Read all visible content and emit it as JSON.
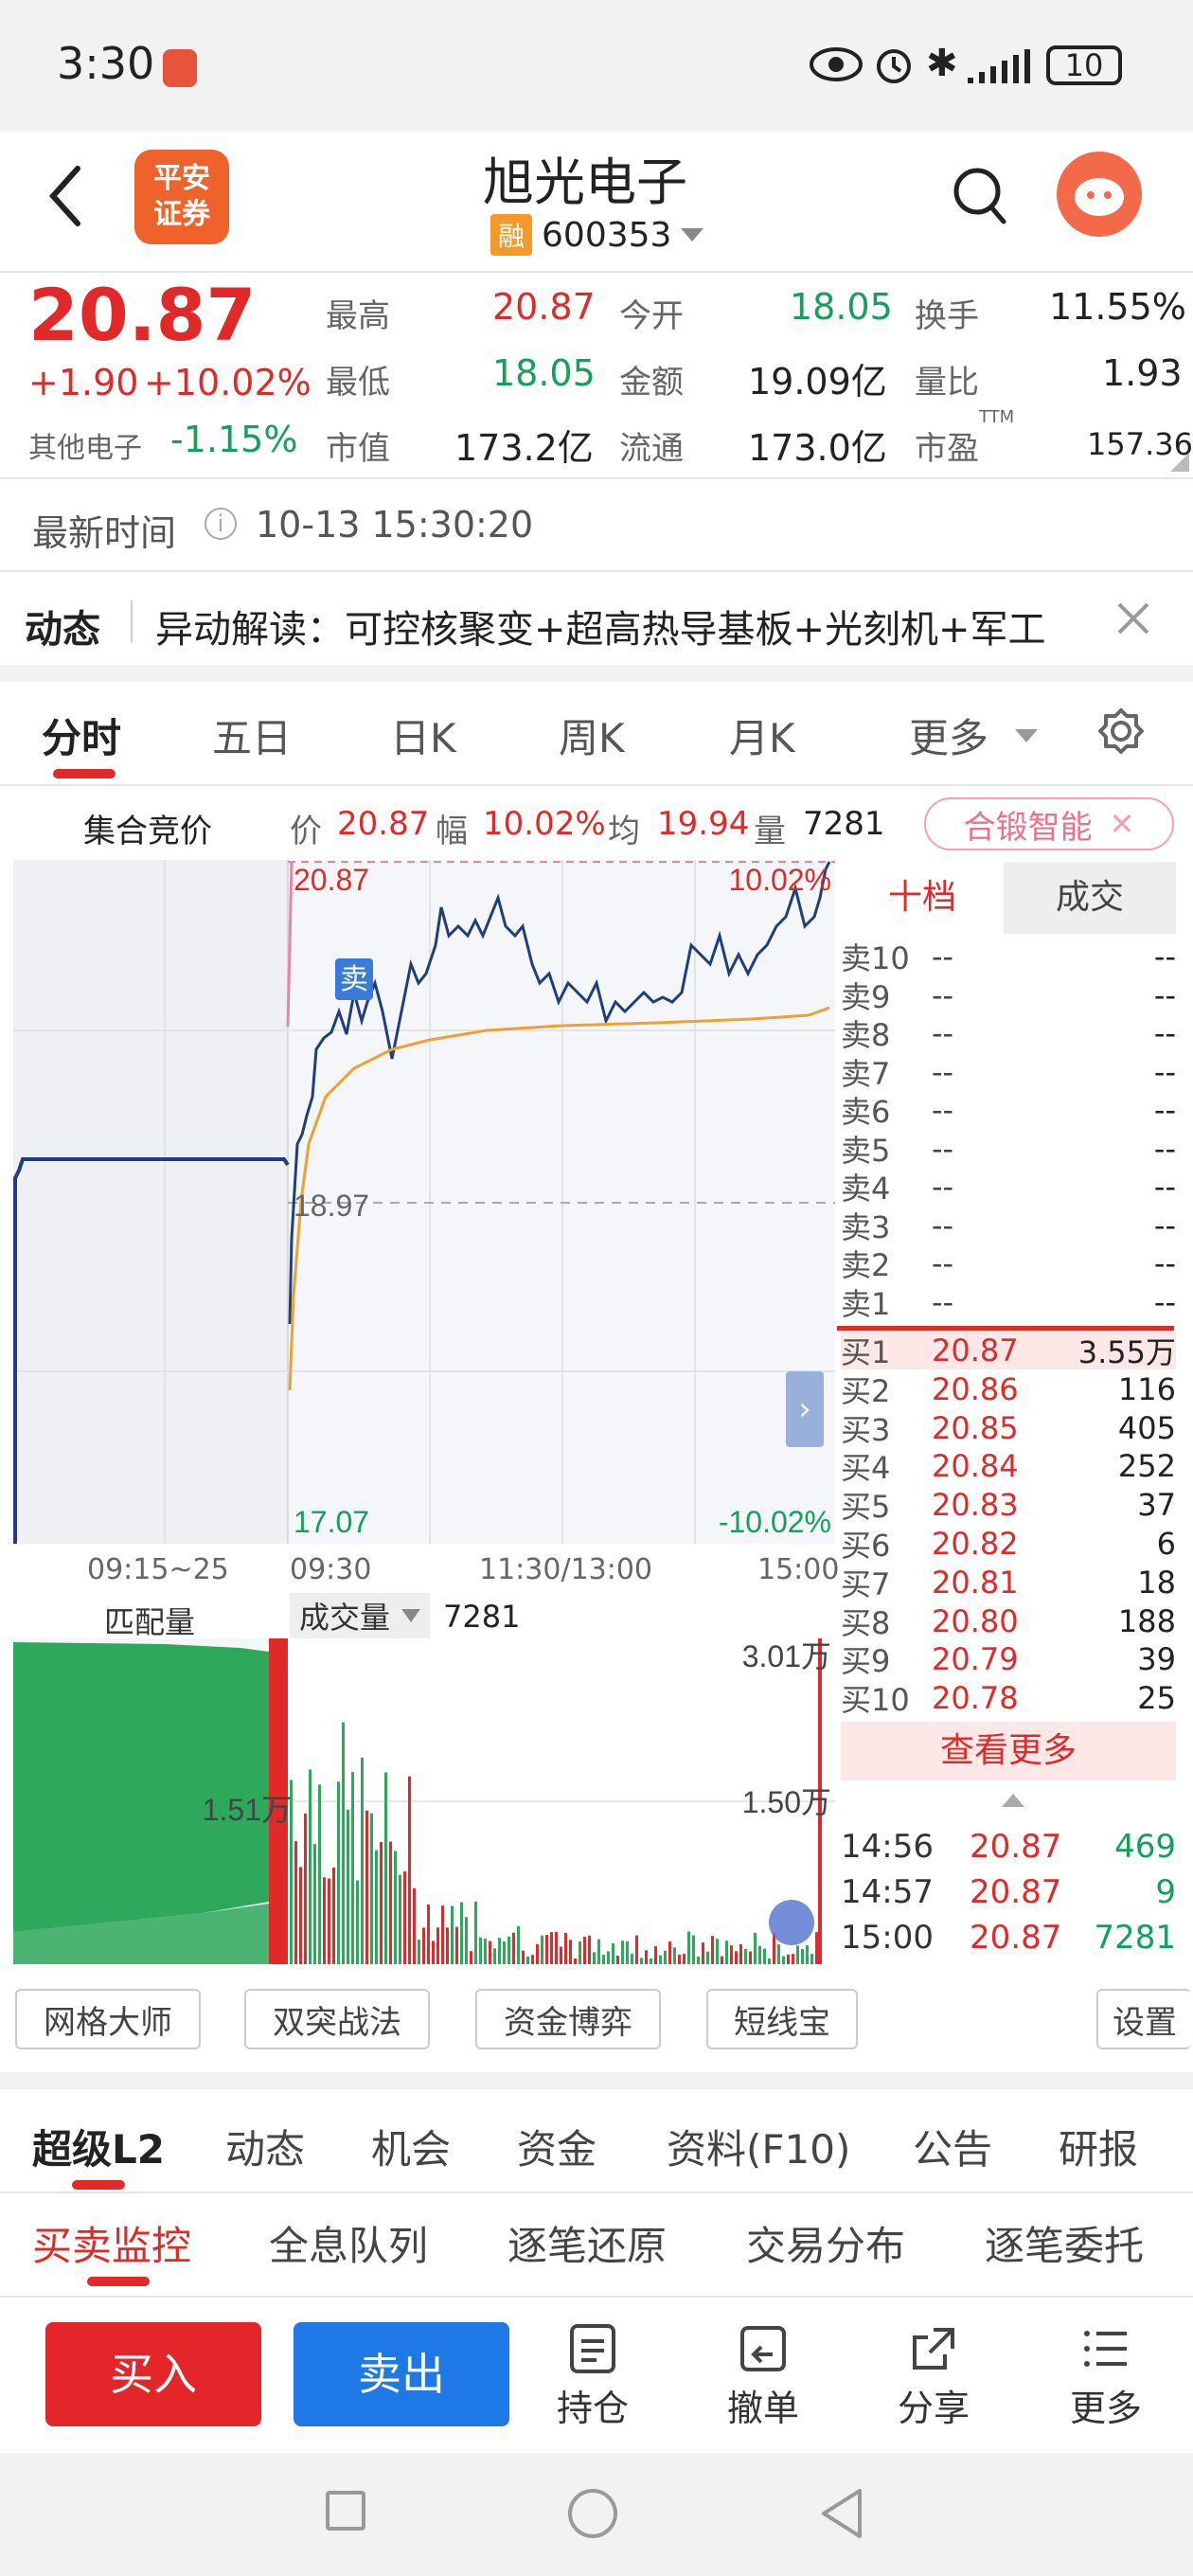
{
  "status_bar": {
    "time": "3:30",
    "battery": "10"
  },
  "header": {
    "broker_logo_text": "平安证券",
    "stock_name": "旭光电子",
    "margin_badge": "融",
    "stock_code": "600353"
  },
  "quote": {
    "price": "20.87",
    "change": "+1.90",
    "change_pct": "+10.02%",
    "sector_label": "其他电子",
    "sector_change": "-1.15%",
    "high_label": "最高",
    "high": "20.87",
    "open_label": "今开",
    "open": "18.05",
    "turnover_label": "换手",
    "turnover": "11.55%",
    "low_label": "最低",
    "low": "18.05",
    "amount_label": "金额",
    "amount": "19.09亿",
    "vol_ratio_label": "量比",
    "vol_ratio": "1.93",
    "mktcap_label": "市值",
    "mktcap": "173.2亿",
    "float_label": "流通",
    "float": "173.0亿",
    "pe_label": "市盈",
    "pe_sup": "TTM",
    "pe": "157.36"
  },
  "latest_time": {
    "label": "最新时间",
    "value": "10-13 15:30:20"
  },
  "news": {
    "tag": "动态",
    "text": "异动解读：可控核聚变+超高热导基板+光刻机+军工"
  },
  "chart_tabs": [
    "分时",
    "五日",
    "日K",
    "周K",
    "月K",
    "更多"
  ],
  "auction": {
    "label": "集合竞价",
    "price_label": "价",
    "price": "20.87",
    "pct_label": "幅",
    "pct": "10.02%",
    "avg_label": "均",
    "avg": "19.94",
    "vol_label": "量",
    "vol": "7281",
    "ai_label": "合锻智能"
  },
  "chart_labels": {
    "top_price": "20.87",
    "top_pct": "10.02%",
    "mid_price": "18.97",
    "bot_price": "17.07",
    "bot_pct": "-10.02%",
    "sell_marker": "卖",
    "t1": "09:15~25",
    "t2": "09:30",
    "t3": "11:30/13:00",
    "t4": "15:00"
  },
  "volume_panel": {
    "match_label": "匹配量",
    "vol_label": "成交量",
    "vol_value": "7281",
    "max_label": "3.01万",
    "mid_label": "1.50万",
    "auction_mid": "1.51万"
  },
  "orderbook": {
    "tab1": "十档",
    "tab2": "成交",
    "asks": [
      {
        "l": "卖10",
        "p": "--",
        "v": "--"
      },
      {
        "l": "卖9",
        "p": "--",
        "v": "--"
      },
      {
        "l": "卖8",
        "p": "--",
        "v": "--"
      },
      {
        "l": "卖7",
        "p": "--",
        "v": "--"
      },
      {
        "l": "卖6",
        "p": "--",
        "v": "--"
      },
      {
        "l": "卖5",
        "p": "--",
        "v": "--"
      },
      {
        "l": "卖4",
        "p": "--",
        "v": "--"
      },
      {
        "l": "卖3",
        "p": "--",
        "v": "--"
      },
      {
        "l": "卖2",
        "p": "--",
        "v": "--"
      },
      {
        "l": "卖1",
        "p": "--",
        "v": "--"
      }
    ],
    "bids": [
      {
        "l": "买1",
        "p": "20.87",
        "v": "3.55万"
      },
      {
        "l": "买2",
        "p": "20.86",
        "v": "116"
      },
      {
        "l": "买3",
        "p": "20.85",
        "v": "405"
      },
      {
        "l": "买4",
        "p": "20.84",
        "v": "252"
      },
      {
        "l": "买5",
        "p": "20.83",
        "v": "37"
      },
      {
        "l": "买6",
        "p": "20.82",
        "v": "6"
      },
      {
        "l": "买7",
        "p": "20.81",
        "v": "18"
      },
      {
        "l": "买8",
        "p": "20.80",
        "v": "188"
      },
      {
        "l": "买9",
        "p": "20.79",
        "v": "39"
      },
      {
        "l": "买10",
        "p": "20.78",
        "v": "25"
      }
    ],
    "more": "查看更多",
    "trades": [
      {
        "t": "14:56",
        "p": "20.87",
        "v": "469"
      },
      {
        "t": "14:57",
        "p": "20.87",
        "v": "9"
      },
      {
        "t": "15:00",
        "p": "20.87",
        "v": "7281"
      }
    ]
  },
  "tools": [
    "网格大师",
    "双突战法",
    "资金博弈",
    "短线宝",
    "设置"
  ],
  "info_tabs": [
    "超级L2",
    "动态",
    "机会",
    "资金",
    "资料(F10)",
    "公告",
    "研报"
  ],
  "sub_tabs": [
    "买卖监控",
    "全息队列",
    "逐笔还原",
    "交易分布",
    "逐笔委托"
  ],
  "actions": {
    "buy": "买入",
    "sell": "卖出",
    "hold": "持仓",
    "cancel": "撤单",
    "share": "分享",
    "more": "更多"
  },
  "colors": {
    "red": "#e02a2a",
    "green": "#13a05b",
    "blue": "#1f3f7a",
    "orange": "#f0a030",
    "buy_btn": "#e4262b",
    "sell_btn": "#1e78e6"
  }
}
